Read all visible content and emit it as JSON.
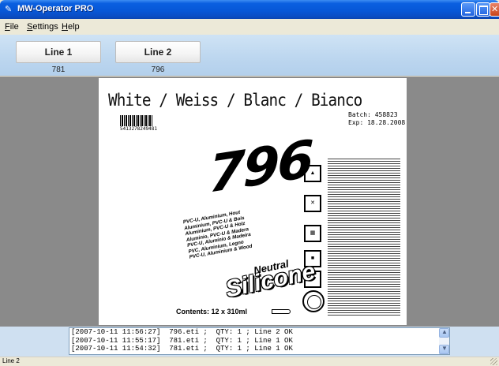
{
  "window": {
    "title": "MW-Operator PRO"
  },
  "menu": {
    "items": [
      "File",
      "Settings",
      "Help"
    ]
  },
  "lines": [
    {
      "label": "Line 1",
      "count": "781"
    },
    {
      "label": "Line 2",
      "count": "796"
    }
  ],
  "label_preview": {
    "heading": "White / Weiss / Blanc / Bianco",
    "barcode_number": "5413278249481",
    "batch": "Batch: 458823",
    "expiry": "Exp:  18.28.2008",
    "product_number": "796",
    "compatibility": [
      "PVC-U, Aluminium, Hout",
      "Aluminium, PVC-U & Bois",
      "Aluminium, PVC-U & Holz",
      "Aluminio, PVC-U & Madera",
      "PVC-U, Alumínio & Madeira",
      "PVC, Aluminium, Legno",
      "PVC-U, Aluminium & Wood"
    ],
    "neutral": "Neutral",
    "silicone": "Silicone",
    "contents": "Contents: 12 x 310ml"
  },
  "log": {
    "entries": [
      "[2007-10-11 11:56:27]  796.eti ;  QTY: 1 ; Line 2 OK",
      "[2007-10-11 11:55:17]  781.eti ;  QTY: 1 ; Line 1 OK",
      "[2007-10-11 11:54:32]  781.eti ;  QTY: 1 ; Line 1 OK"
    ]
  },
  "status": {
    "text": "Line 2"
  }
}
